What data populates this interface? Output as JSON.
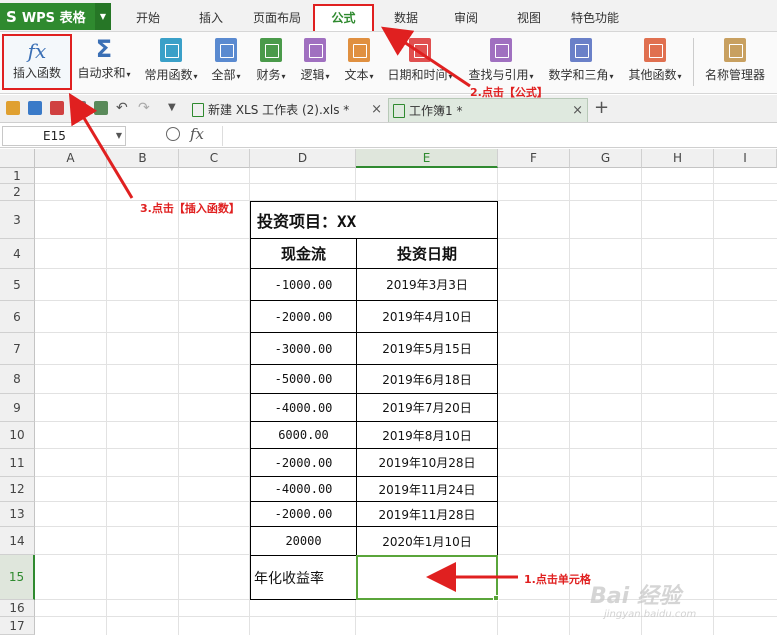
{
  "app": {
    "name": "WPS 表格",
    "logo": "S"
  },
  "menu_tabs": [
    "开始",
    "插入",
    "页面布局",
    "公式",
    "数据",
    "审阅",
    "视图",
    "特色功能"
  ],
  "active_menu_tab": "公式",
  "ribbon": {
    "insert_function": {
      "icon": "fx",
      "label": "插入函数"
    },
    "autosum": {
      "label": "自动求和"
    },
    "groups": [
      {
        "label": "常用函数",
        "color": "#3aa0c8"
      },
      {
        "label": "全部",
        "color": "#5a8ad0"
      },
      {
        "label": "财务",
        "color": "#4a9a4a"
      },
      {
        "label": "逻辑",
        "color": "#a070c0"
      },
      {
        "label": "文本",
        "color": "#e09040"
      },
      {
        "label": "日期和时间",
        "color": "#e05050"
      },
      {
        "label": "查找与引用",
        "color": "#a070c0"
      },
      {
        "label": "数学和三角",
        "color": "#6a80c8"
      },
      {
        "label": "其他函数",
        "color": "#e07050"
      }
    ],
    "name_manager": {
      "label": "名称管理器"
    }
  },
  "doc_tabs": [
    {
      "label": "新建 XLS 工作表 (2).xls *",
      "active": false
    },
    {
      "label": "工作簿1 *",
      "active": true
    }
  ],
  "formula_bar": {
    "cell_ref": "E15",
    "fx": "fx",
    "value": ""
  },
  "columns": [
    "A",
    "B",
    "C",
    "D",
    "E",
    "F",
    "G",
    "H",
    "I"
  ],
  "selected_column": "E",
  "rows": [
    "1",
    "2",
    "3",
    "4",
    "5",
    "6",
    "7",
    "8",
    "9",
    "10",
    "11",
    "12",
    "13",
    "14",
    "15",
    "16",
    "17"
  ],
  "selected_row": "15",
  "table": {
    "title": "投资项目：XX",
    "headers": [
      "现金流",
      "投资日期"
    ],
    "rows": [
      {
        "cash": "-1000.00",
        "date": "2019年3月3日"
      },
      {
        "cash": "-2000.00",
        "date": "2019年4月10日"
      },
      {
        "cash": "-3000.00",
        "date": "2019年5月15日"
      },
      {
        "cash": "-5000.00",
        "date": "2019年6月18日"
      },
      {
        "cash": "-4000.00",
        "date": "2019年7月20日"
      },
      {
        "cash": "6000.00",
        "date": "2019年8月10日"
      },
      {
        "cash": "-2000.00",
        "date": "2019年10月28日"
      },
      {
        "cash": "-4000.00",
        "date": "2019年11月24日"
      },
      {
        "cash": "-2000.00",
        "date": "2019年11月28日"
      },
      {
        "cash": "20000",
        "date": "2020年1月10日"
      }
    ],
    "result_label": "年化收益率",
    "result_value": ""
  },
  "annotations": {
    "step1": "1.点击单元格",
    "step2": "2.点击【公式】",
    "step3": "3.点击【插入函数】"
  },
  "watermark": {
    "text": "Bai 经验",
    "sub": "jingyan.baidu.com"
  },
  "colors": {
    "accent": "#2f8a2f",
    "annotation": "#e02020",
    "selection": "#5aa53a"
  }
}
